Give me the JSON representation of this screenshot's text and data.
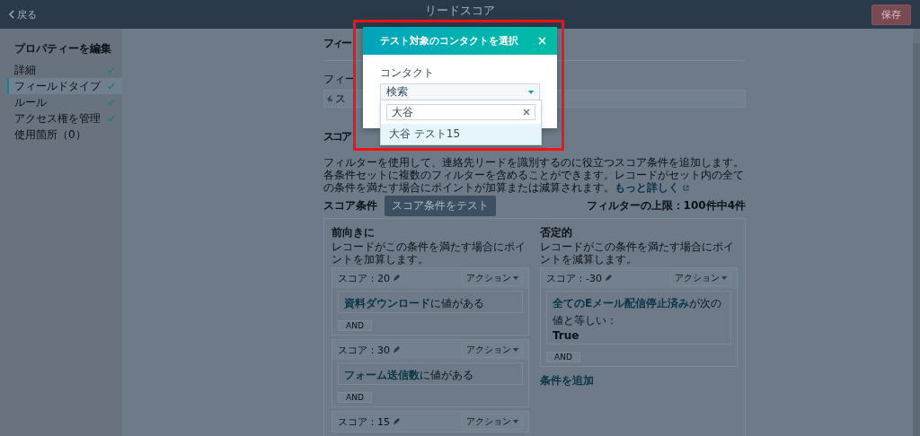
{
  "header": {
    "back": "戻る",
    "title": "リードスコア",
    "save": "保存"
  },
  "sidebar": {
    "title": "プロパティーを編集",
    "items": [
      {
        "label": "詳細",
        "done": true,
        "selected": false
      },
      {
        "label": "フィールドタイプ",
        "done": true,
        "selected": true
      },
      {
        "label": "ルール",
        "done": true,
        "selected": false
      },
      {
        "label": "アクセス権を管理",
        "done": true,
        "selected": false
      },
      {
        "label": "使用箇所（0）",
        "done": false,
        "selected": false
      }
    ]
  },
  "field_section": {
    "heading": "フィー",
    "label": "フィー",
    "value": "ス"
  },
  "score_section": {
    "heading": "スコア",
    "description": "フィルターを使用して、連絡先リードを識別するのに役立つスコア条件を追加します。各条件セットに複数のフィルターを含めることができます。レコードがセット内の全ての条件を満たす場合にポイントが加算または減算されます。",
    "learn_more": "もっと詳しく",
    "conditions_label": "スコア条件",
    "test_button": "スコア条件をテスト",
    "limit": "フィルターの上限：100件中4件",
    "columns": [
      {
        "title": "前向きに",
        "description": "レコードがこの条件を満たす場合にポイントを加算します。",
        "groups": [
          {
            "score": "スコア：20",
            "actions": "アクション",
            "conditions": [
              {
                "property": "資料ダウンロード",
                "predicate": "に値がある"
              }
            ],
            "and": "AND"
          },
          {
            "score": "スコア：30",
            "actions": "アクション",
            "conditions": [
              {
                "property": "フォーム送信数",
                "predicate": "に値がある"
              }
            ],
            "and": "AND"
          },
          {
            "score": "スコア：15",
            "actions": "アクション"
          }
        ]
      },
      {
        "title": "否定的",
        "description": "レコードがこの条件を満たす場合にポイントを減算します。",
        "groups": [
          {
            "score": "スコア：-30",
            "actions": "アクション",
            "conditions": [
              {
                "property": "全てのEメール配信停止済み",
                "predicate": "が次の値と等しい：",
                "value": "True"
              }
            ],
            "and": "AND"
          }
        ],
        "add_condition": "条件を追加"
      }
    ]
  },
  "modal": {
    "title": "テスト対象のコンタクトを選択",
    "field_label": "コンタクト",
    "select_placeholder": "検索",
    "search_value": "大谷",
    "results": [
      {
        "label": "大谷 テスト15",
        "selected": true
      }
    ]
  }
}
